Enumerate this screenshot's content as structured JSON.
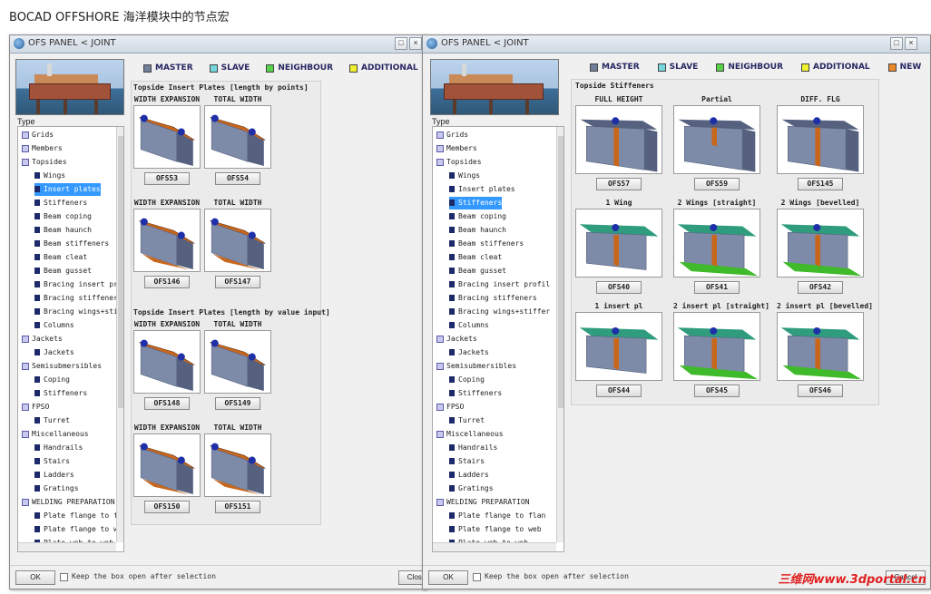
{
  "page_title": "BOCAD OFFSHORE 海洋模块中的节点宏",
  "colors": {
    "master": "#6f7f9a",
    "slave": "#76d6dc",
    "neighbour": "#58d24a",
    "additional": "#f0f02e",
    "new": "#e9882a",
    "selected": "#3399ff"
  },
  "legend": [
    {
      "label": "MASTER",
      "color": "#6f7f9a"
    },
    {
      "label": "SLAVE",
      "color": "#76d6dc"
    },
    {
      "label": "NEIGHBOUR",
      "color": "#58d24a"
    },
    {
      "label": "ADDITIONAL",
      "color": "#f0f02e"
    },
    {
      "label": "NEW",
      "color": "#e9882a"
    }
  ],
  "window_left": {
    "title": "OFS PANEL < JOINT",
    "type_label": "Type",
    "tree": [
      {
        "label": "Grids",
        "level": 0
      },
      {
        "label": "Members",
        "level": 0
      },
      {
        "label": "Topsides",
        "level": 0
      },
      {
        "label": "Wings",
        "level": 1
      },
      {
        "label": "Insert plates",
        "level": 1,
        "selected": true
      },
      {
        "label": "Stiffeners",
        "level": 1
      },
      {
        "label": "Beam coping",
        "level": 1
      },
      {
        "label": "Beam haunch",
        "level": 1
      },
      {
        "label": "Beam stiffeners",
        "level": 1
      },
      {
        "label": "Beam cleat",
        "level": 1
      },
      {
        "label": "Beam gusset",
        "level": 1
      },
      {
        "label": "Bracing insert profil",
        "level": 1
      },
      {
        "label": "Bracing stiffeners",
        "level": 1
      },
      {
        "label": "Bracing wings+stiffe",
        "level": 1
      },
      {
        "label": "Columns",
        "level": 1
      },
      {
        "label": "Jackets",
        "level": 0
      },
      {
        "label": "Jackets",
        "level": 1
      },
      {
        "label": "Semisubmersibles",
        "level": 0
      },
      {
        "label": "Coping",
        "level": 1
      },
      {
        "label": "Stiffeners",
        "level": 1
      },
      {
        "label": "FPSO",
        "level": 0
      },
      {
        "label": "Turret",
        "level": 1
      },
      {
        "label": "Miscellaneous",
        "level": 0
      },
      {
        "label": "Handrails",
        "level": 1
      },
      {
        "label": "Stairs",
        "level": 1
      },
      {
        "label": "Ladders",
        "level": 1
      },
      {
        "label": "Gratings",
        "level": 1
      },
      {
        "label": "WELDING PREPARATION",
        "level": 0
      },
      {
        "label": "Plate flange to flan",
        "level": 1
      },
      {
        "label": "Plate flange to web",
        "level": 1
      },
      {
        "label": "Plate web to web",
        "level": 1
      }
    ],
    "group1_title": "Topside Insert Plates [length by points]",
    "group2_title": "Topside Insert Plates [length by value input]",
    "cells": [
      {
        "head": "WIDTH EXPANSION",
        "button": "OFS53",
        "kind": "insert-diag"
      },
      {
        "head": "TOTAL WIDTH",
        "button": "OFS54",
        "kind": "insert-diag"
      },
      {
        "head": "WIDTH EXPANSION",
        "button": "OFS146",
        "kind": "insert-diag-tall"
      },
      {
        "head": "TOTAL WIDTH",
        "button": "OFS147",
        "kind": "insert-diag-tall"
      },
      {
        "head": "WIDTH EXPANSION",
        "button": "OFS148",
        "kind": "insert-diag"
      },
      {
        "head": "TOTAL WIDTH",
        "button": "OFS149",
        "kind": "insert-diag"
      },
      {
        "head": "WIDTH EXPANSION",
        "button": "OFS150",
        "kind": "insert-diag-tall"
      },
      {
        "head": "TOTAL WIDTH",
        "button": "OFS151",
        "kind": "insert-diag-tall"
      }
    ],
    "ok_label": "OK",
    "keep_open_label": "Keep the box open after selection",
    "close_label": "Close"
  },
  "window_right": {
    "title": "OFS PANEL < JOINT",
    "type_label": "Type",
    "tree": [
      {
        "label": "Grids",
        "level": 0
      },
      {
        "label": "Members",
        "level": 0
      },
      {
        "label": "Topsides",
        "level": 0
      },
      {
        "label": "Wings",
        "level": 1
      },
      {
        "label": "Insert plates",
        "level": 1
      },
      {
        "label": "Stiffeners",
        "level": 1,
        "selected": true
      },
      {
        "label": "Beam coping",
        "level": 1
      },
      {
        "label": "Beam haunch",
        "level": 1
      },
      {
        "label": "Beam stiffeners",
        "level": 1
      },
      {
        "label": "Beam cleat",
        "level": 1
      },
      {
        "label": "Beam gusset",
        "level": 1
      },
      {
        "label": "Bracing insert profil",
        "level": 1
      },
      {
        "label": "Bracing stiffeners",
        "level": 1
      },
      {
        "label": "Bracing wings+stiffer",
        "level": 1
      },
      {
        "label": "Columns",
        "level": 1
      },
      {
        "label": "Jackets",
        "level": 0
      },
      {
        "label": "Jackets",
        "level": 1
      },
      {
        "label": "Semisubmersibles",
        "level": 0
      },
      {
        "label": "Coping",
        "level": 1
      },
      {
        "label": "Stiffeners",
        "level": 1
      },
      {
        "label": "FPSO",
        "level": 0
      },
      {
        "label": "Turret",
        "level": 1
      },
      {
        "label": "Miscellaneous",
        "level": 0
      },
      {
        "label": "Handrails",
        "level": 1
      },
      {
        "label": "Stairs",
        "level": 1
      },
      {
        "label": "Ladders",
        "level": 1
      },
      {
        "label": "Gratings",
        "level": 1
      },
      {
        "label": "WELDING PREPARATION",
        "level": 0
      },
      {
        "label": "Plate flange to flan",
        "level": 1
      },
      {
        "label": "Plate flange to web",
        "level": 1
      },
      {
        "label": "Plate web to web",
        "level": 1
      }
    ],
    "group_title": "Topside Stiffeners",
    "cells": [
      {
        "head": "FULL HEIGHT",
        "button": "OFS57",
        "kind": "stiff-full"
      },
      {
        "head": "Partial",
        "button": "OFS59",
        "kind": "stiff-partial"
      },
      {
        "head": "DIFF. FLG",
        "button": "OFS145",
        "kind": "stiff-diff"
      },
      {
        "head": "1 Wing",
        "button": "OFS40",
        "kind": "wing-1"
      },
      {
        "head": "2 Wings [straight]",
        "button": "OFS41",
        "kind": "wing-2"
      },
      {
        "head": "2 Wings [bevelled]",
        "button": "OFS42",
        "kind": "wing-2"
      },
      {
        "head": "1 insert pl",
        "button": "OFS44",
        "kind": "wing-1"
      },
      {
        "head": "2 insert pl [straight]",
        "button": "OFS45",
        "kind": "wing-2"
      },
      {
        "head": "2 insert pl [bevelled]",
        "button": "OFS46",
        "kind": "wing-2"
      }
    ],
    "ok_label": "OK",
    "keep_open_label": "Keep the box open after selection",
    "cancel_label": "Cancel"
  },
  "watermark": "三维网www.3dportal.cn"
}
